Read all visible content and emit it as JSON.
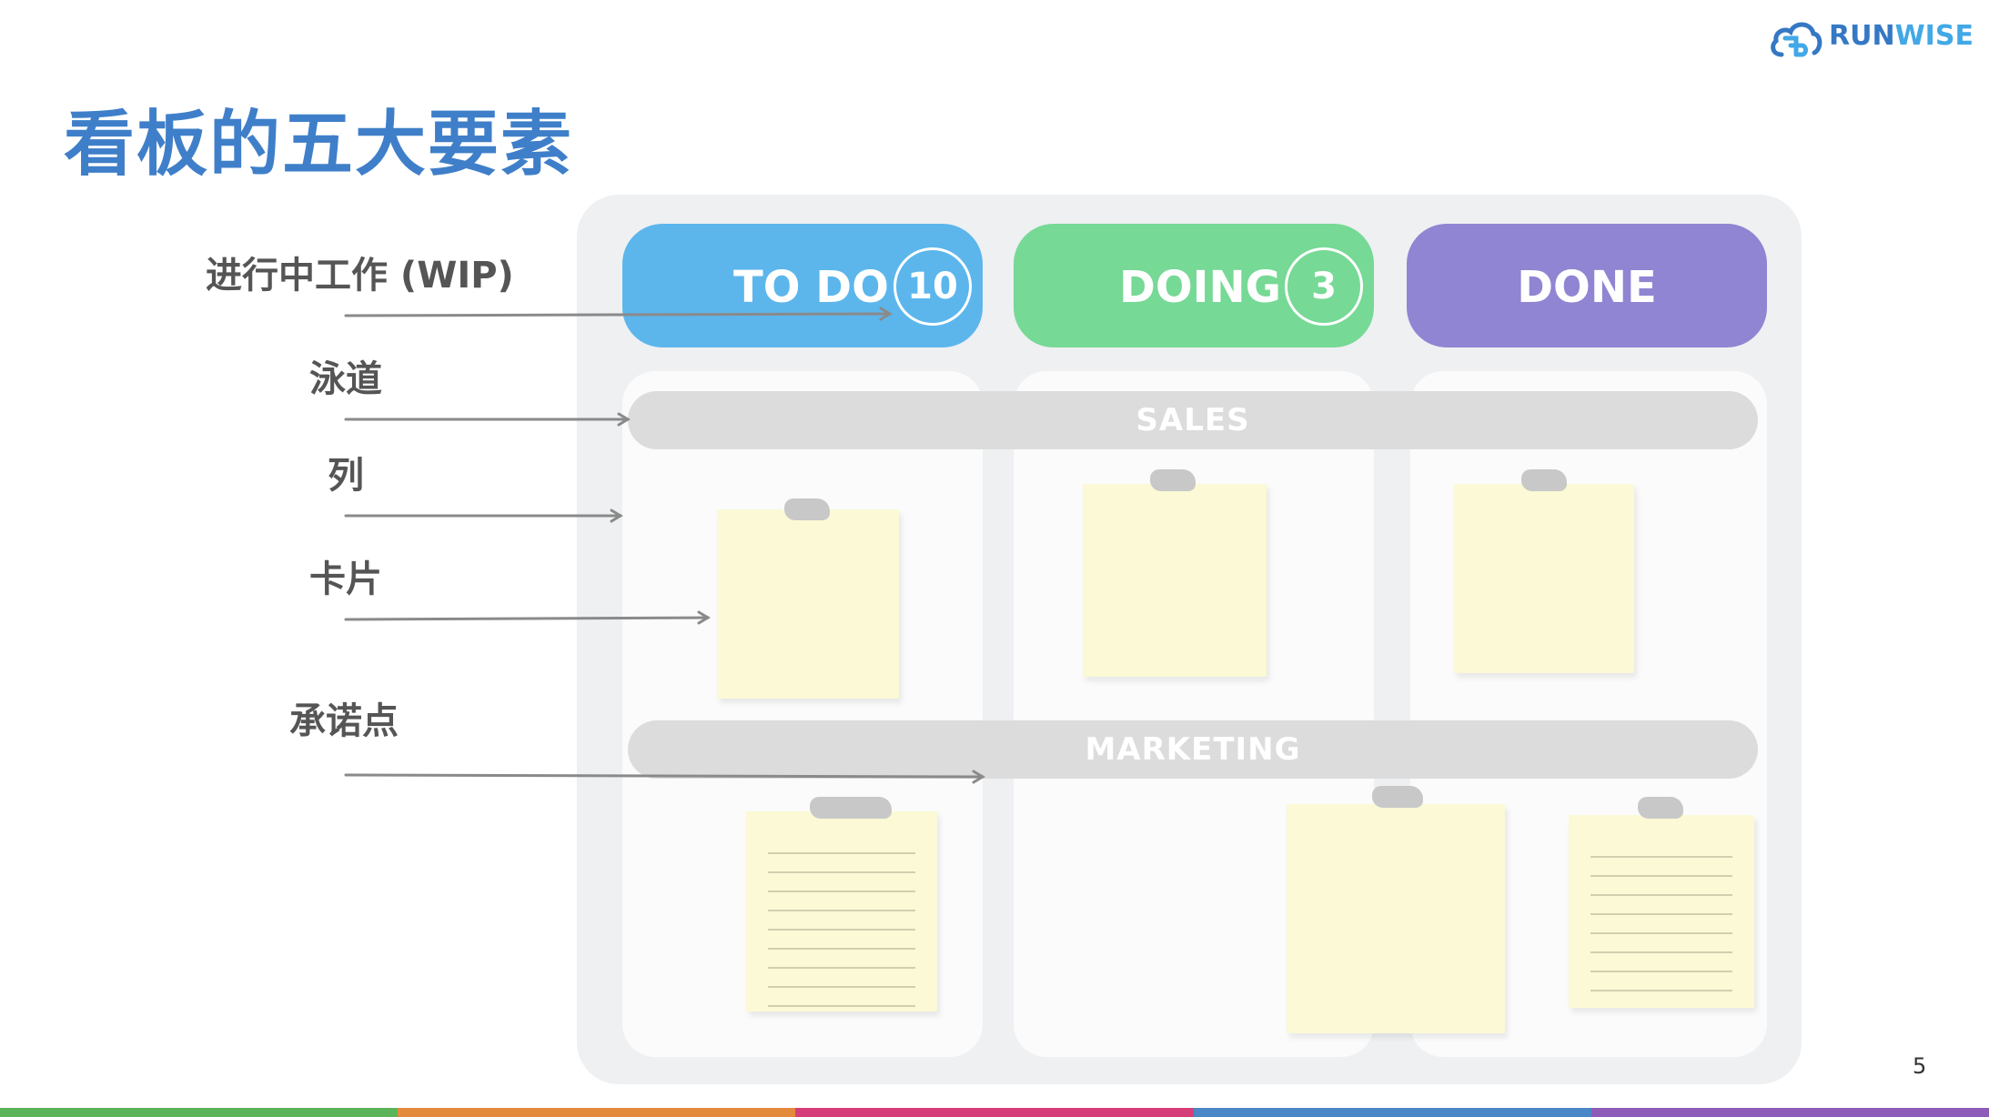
{
  "logo": {
    "part1": "RUN",
    "part2": "WISE",
    "icon": "cloud-logo-icon"
  },
  "title": "看板的五大要素",
  "labels": {
    "wip": "进行中工作 (WIP)",
    "swimlane": "泳道",
    "column": "列",
    "card": "卡片",
    "commitment": "承诺点"
  },
  "board": {
    "columns": [
      {
        "label": "TO DO",
        "wip": "10",
        "color": "#5cb6ec"
      },
      {
        "label": "DOING",
        "wip": "3",
        "color": "#76d995"
      },
      {
        "label": "DONE",
        "color": "#8f85d2"
      }
    ],
    "lanes": [
      "SALES",
      "MARKETING"
    ]
  },
  "page_number": "5",
  "colors": {
    "title": "#3f7fc9",
    "note": "#fbf9d6",
    "bottom_bar": [
      "#5bb35a",
      "#e38a3d",
      "#d63e79",
      "#4b86c6",
      "#8d5bb8"
    ]
  }
}
